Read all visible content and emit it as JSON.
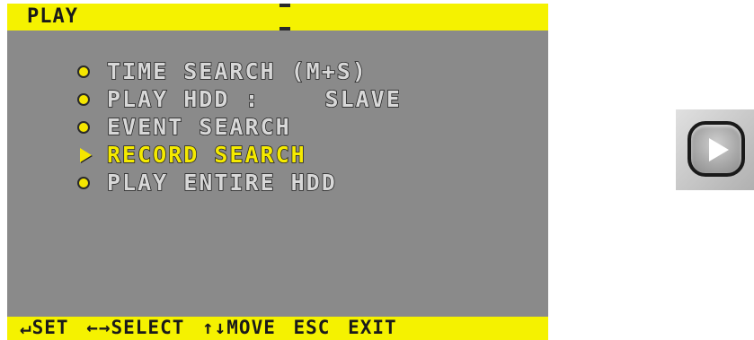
{
  "header": {
    "title": "PLAY"
  },
  "menu": {
    "items": [
      {
        "label": "TIME SEARCH (M+S)",
        "marker": "bullet-icon",
        "selected": false
      },
      {
        "label": "PLAY HDD :",
        "value": "SLAVE",
        "marker": "bullet-icon",
        "selected": false
      },
      {
        "label": "EVENT SEARCH",
        "marker": "bullet-icon",
        "selected": false
      },
      {
        "label": "RECORD SEARCH",
        "marker": "arrow-right-icon",
        "selected": true
      },
      {
        "label": "PLAY ENTIRE HDD",
        "marker": "bullet-icon",
        "selected": false
      }
    ]
  },
  "footer": {
    "hint": "↵SET ←→SELECT ↑↓MOVE ESC EXIT"
  },
  "play_button": {
    "icon": "play-icon"
  },
  "colors": {
    "bar_yellow": "#f5f200",
    "panel_gray": "#8a8a8a",
    "selected_text": "#f5ea00",
    "normal_text": "#d8d8d8"
  }
}
